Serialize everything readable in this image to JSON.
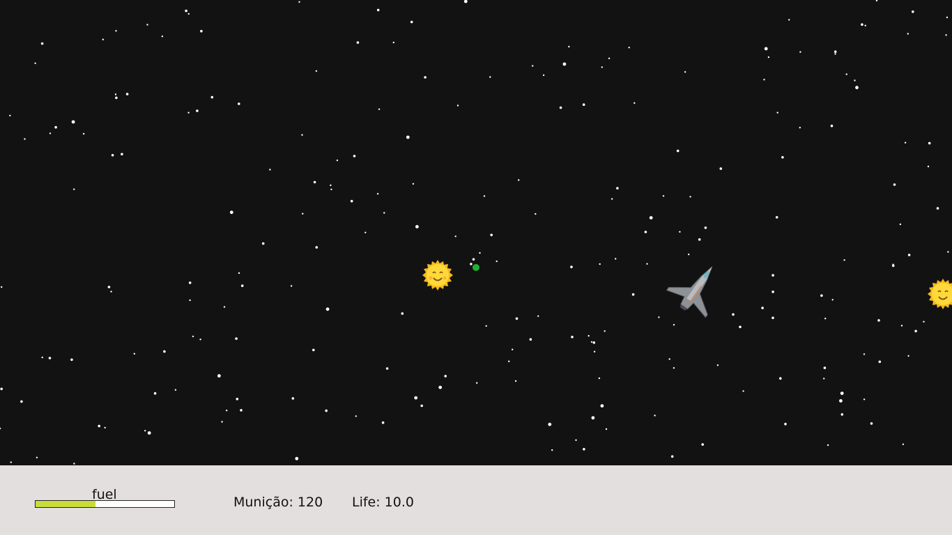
{
  "hud": {
    "fuel_label": "fuel",
    "fuel_level": 0.43,
    "ammo_text": "Munição: 120",
    "life_text": "Life: 10.0"
  },
  "colors": {
    "space": "#121212",
    "hud_background": "#e4dfdf",
    "fuel_fill": "#c9dc3a",
    "bullet": "#22b032",
    "sun": "#ffd428"
  },
  "sprites": {
    "enemy_icon": "smiling-sun-icon",
    "player_icon": "spaceship-icon",
    "projectile_icon": "green-bullet-icon"
  }
}
